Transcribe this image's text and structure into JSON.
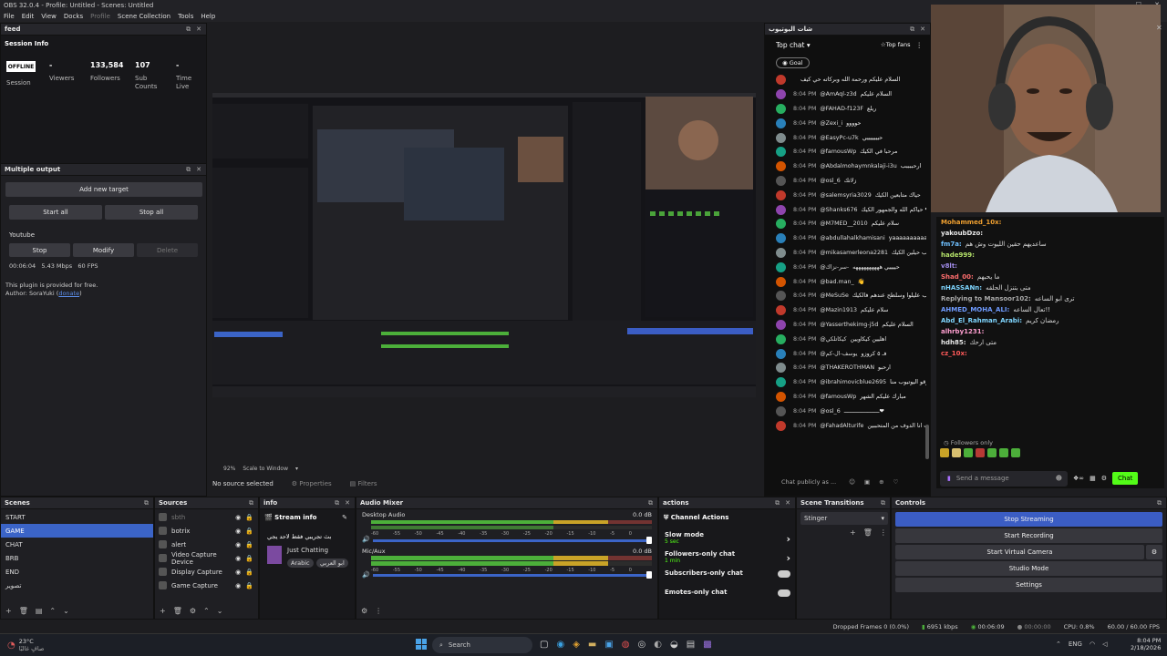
{
  "window_title": "OBS 32.0.4 - Profile: Untitled - Scenes: Untitled",
  "menu": [
    "File",
    "Edit",
    "View",
    "Docks",
    "Profile",
    "Scene Collection",
    "Tools",
    "Help"
  ],
  "feed": {
    "title": "feed",
    "session_info": "Session Info",
    "status": "OFFLINE",
    "session_label": "Session",
    "stats": [
      {
        "value": "-",
        "label": "Viewers"
      },
      {
        "value": "133,584",
        "label": "Followers"
      },
      {
        "value": "107",
        "label": "Sub Counts"
      },
      {
        "value": "-",
        "label": "Time Live"
      }
    ]
  },
  "multiple_output": {
    "title": "Multiple output",
    "add_target": "Add new target",
    "start_all": "Start all",
    "stop_all": "Stop all",
    "target_name": "Youtube",
    "stop": "Stop",
    "modify": "Modify",
    "delete": "Delete",
    "status_line": "00:06:04   5.43 Mbps   60 FPS",
    "note": "This plugin is provided for free.",
    "author_prefix": "Author: SoraYuki (",
    "author_link": "donate",
    "author_suffix": ")"
  },
  "preview": {
    "zoom": "92%",
    "scale": "Scale to Window",
    "no_source": "No source selected",
    "properties": "Properties",
    "filters": "Filters"
  },
  "youtube_chat": {
    "title": "شات اليوتيوب",
    "top_chat": "Top chat",
    "top_fans": "Top fans",
    "goal": "Goal",
    "input_placeholder": "Chat publicly as ...",
    "messages": [
      {
        "time": "",
        "user": "",
        "msg": "السلام عليكم ورحمة الله وبركاته حي كيف"
      },
      {
        "time": "8:04 PM",
        "user": "@AmAql-z3d",
        "msg": "السلام عليكم"
      },
      {
        "time": "8:04 PM",
        "user": "@FAHAD-f123F",
        "msg": "ريلع"
      },
      {
        "time": "8:04 PM",
        "user": "@Zexi_i",
        "msg": "حوووو"
      },
      {
        "time": "8:04 PM",
        "user": "@EasyPc-u7k",
        "msg": "حيييييييي"
      },
      {
        "time": "8:04 PM",
        "user": "@famousWp",
        "msg": "مرحبا في الكيك"
      },
      {
        "time": "8:04 PM",
        "user": "@Abdalmohaymnkalaji-i3u",
        "msg": "ارحببببب"
      },
      {
        "time": "8:04 PM",
        "user": "@osl_6",
        "msg": "زلاتك"
      },
      {
        "time": "8:04 PM",
        "user": "@salemsyria3029",
        "msg": "حياك متابعين الكيك"
      },
      {
        "time": "8:04 PM",
        "user": "@Shanks676",
        "msg": "حياكم الله والجمهور الكيك ❤❤❤❤"
      },
      {
        "time": "8:04 PM",
        "user": "@M7MED__2010",
        "msg": "سلام عليكم"
      },
      {
        "time": "8:04 PM",
        "user": "@abdullahalkhamisani",
        "msg": "yaaaaaaaaaaaaaa db"
      },
      {
        "time": "8:04 PM",
        "user": "@mikasamerleona2281",
        "msg": "ارحب حيلين الكيك"
      },
      {
        "time": "8:04 PM",
        "user": "@سر-نزاك-",
        "msg": "حييييي ههههههههههه"
      },
      {
        "time": "8:04 PM",
        "user": "@bad.man_",
        "msg": "👋"
      },
      {
        "time": "8:04 PM",
        "user": "@MeSuSe",
        "msg": "سلحب عليلوا وسلطح عندهم فالكيك"
      },
      {
        "time": "8:04 PM",
        "user": "@Mazin1913",
        "msg": "سلام عليكم"
      },
      {
        "time": "8:04 PM",
        "user": "@Yasserthekimg-j5d",
        "msg": "السلام عليكم"
      },
      {
        "time": "8:04 PM",
        "user": "@كيكاتلكي",
        "msg": "اهليين كيكاويين"
      },
      {
        "time": "8:04 PM",
        "user": "@يوسف-ال-كم",
        "msg": "فـ ٥ كروزو"
      },
      {
        "time": "8:04 PM",
        "user": "@THAKEROTHMAN",
        "msg": "ارحبو"
      },
      {
        "time": "8:04 PM",
        "user": "@ibrahimovicblue2695",
        "msg": "مطرش حلين كيك خوانه سرقو اليوتيوب منا"
      },
      {
        "time": "8:04 PM",
        "user": "@famousWp",
        "msg": "مبارك عليكم الشهر"
      },
      {
        "time": "8:04 PM",
        "user": "@osl_6",
        "msg": "ـــــــــــــــــــــ❤"
      },
      {
        "time": "8:04 PM",
        "user": "@FahadAlturife",
        "msg": "طيب انا الدوف من المتحببين"
      }
    ]
  },
  "twitch_chat": {
    "messages": [
      {
        "user": "Mohammed_10x:",
        "msg": "",
        "color": "#f0a030"
      },
      {
        "user": "yakoubDzo:",
        "msg": "",
        "color": "#e8e8e8"
      },
      {
        "user": "fm7a:",
        "msg": "ساعديهم حقين الليوت وش هم",
        "color": "#6fc0ff"
      },
      {
        "user": "hade999:",
        "msg": "",
        "color": "#b5e36a"
      },
      {
        "user": "v8lt:",
        "msg": "",
        "color": "#a08be8"
      },
      {
        "user": "Shad_00:",
        "msg": "ما يحبهم",
        "color": "#ff6e6e"
      },
      {
        "user": "nHASSANn:",
        "msg": "متى بتنزل الحلقه",
        "color": "#7fd6ff"
      },
      {
        "user": "Replying to Mansoor102:",
        "msg": "ترى ابو الساعه",
        "color": "#aaaaaa"
      },
      {
        "user": "AHMED_MOHA_ALI:",
        "msg": "تعال الساعه!!",
        "color": "#6f9bff"
      },
      {
        "user": "Abd_El_Rahman_Arabi:",
        "msg": "رمضان كريم",
        "color": "#7fd6ff"
      },
      {
        "user": "alhrby1231:",
        "msg": "",
        "color": "#ff9fd0"
      },
      {
        "user": "hdh85:",
        "msg": "متى ارحك",
        "color": "#e8e8e8"
      },
      {
        "user": "cz_10x:",
        "msg": "",
        "color": "#ff5a5a"
      }
    ],
    "followers_only": "Followers only",
    "send_placeholder": "Send a message",
    "chat_button": "Chat"
  },
  "scenes": {
    "title": "Scenes",
    "items": [
      "START",
      "GAME",
      "CHAT",
      "BRB",
      "END",
      "تصوير"
    ],
    "selected": 1
  },
  "sources": {
    "title": "Sources",
    "items": [
      {
        "name": "sbth",
        "dim": true
      },
      {
        "name": "botrix",
        "dim": false
      },
      {
        "name": "alert",
        "dim": false
      },
      {
        "name": "Video Capture Device",
        "dim": false
      },
      {
        "name": "Display Capture",
        "dim": false
      },
      {
        "name": "Game Capture",
        "dim": false
      }
    ]
  },
  "info": {
    "title": "info",
    "stream_info": "Stream info",
    "stream_title": "بث تجريبي فقط لاحد يجي",
    "category": "Just Chatting",
    "tag1": "Arabic",
    "tag2": "ابو العربي"
  },
  "audio": {
    "title": "Audio Mixer",
    "channels": [
      {
        "name": "Desktop Audio",
        "db": "0.0 dB"
      },
      {
        "name": "Mic/Aux",
        "db": "0.0 dB"
      }
    ],
    "scale": [
      "-60",
      "-55",
      "-50",
      "-45",
      "-40",
      "-35",
      "-30",
      "-25",
      "-20",
      "-15",
      "-10",
      "-5",
      "0"
    ]
  },
  "actions": {
    "title": "actions",
    "heading": "Channel Actions",
    "items": [
      {
        "label": "Slow mode",
        "sub": "5 sec",
        "kind": "arrow"
      },
      {
        "label": "Followers-only chat",
        "sub": "1 min",
        "kind": "arrow"
      },
      {
        "label": "Subscribers-only chat",
        "sub": "",
        "kind": "toggle"
      },
      {
        "label": "Emotes-only chat",
        "sub": "",
        "kind": "toggle"
      }
    ]
  },
  "transitions": {
    "title": "Scene Transitions",
    "selected": "Stinger"
  },
  "controls": {
    "title": "Controls",
    "buttons": [
      "Stop Streaming",
      "Start Recording",
      "Start Virtual Camera",
      "Studio Mode",
      "Settings"
    ]
  },
  "statusbar": {
    "dropped": "Dropped Frames 0 (0.0%)",
    "bitrate": "6951 kbps",
    "stream_time": "00:06:09",
    "rec_time": "00:00:00",
    "cpu": "CPU: 0.8%",
    "fps": "60.00 / 60.00 FPS"
  },
  "taskbar": {
    "weather_temp": "23°C",
    "weather_desc": "صافٍ غالبًا",
    "search": "Search",
    "time": "8:04 PM",
    "date": "2/18/2026",
    "lang": "ENG"
  },
  "colors": {
    "accent": "#3b64c7",
    "chat_button": "#53fc18",
    "offline_bg": "#ffffff"
  }
}
